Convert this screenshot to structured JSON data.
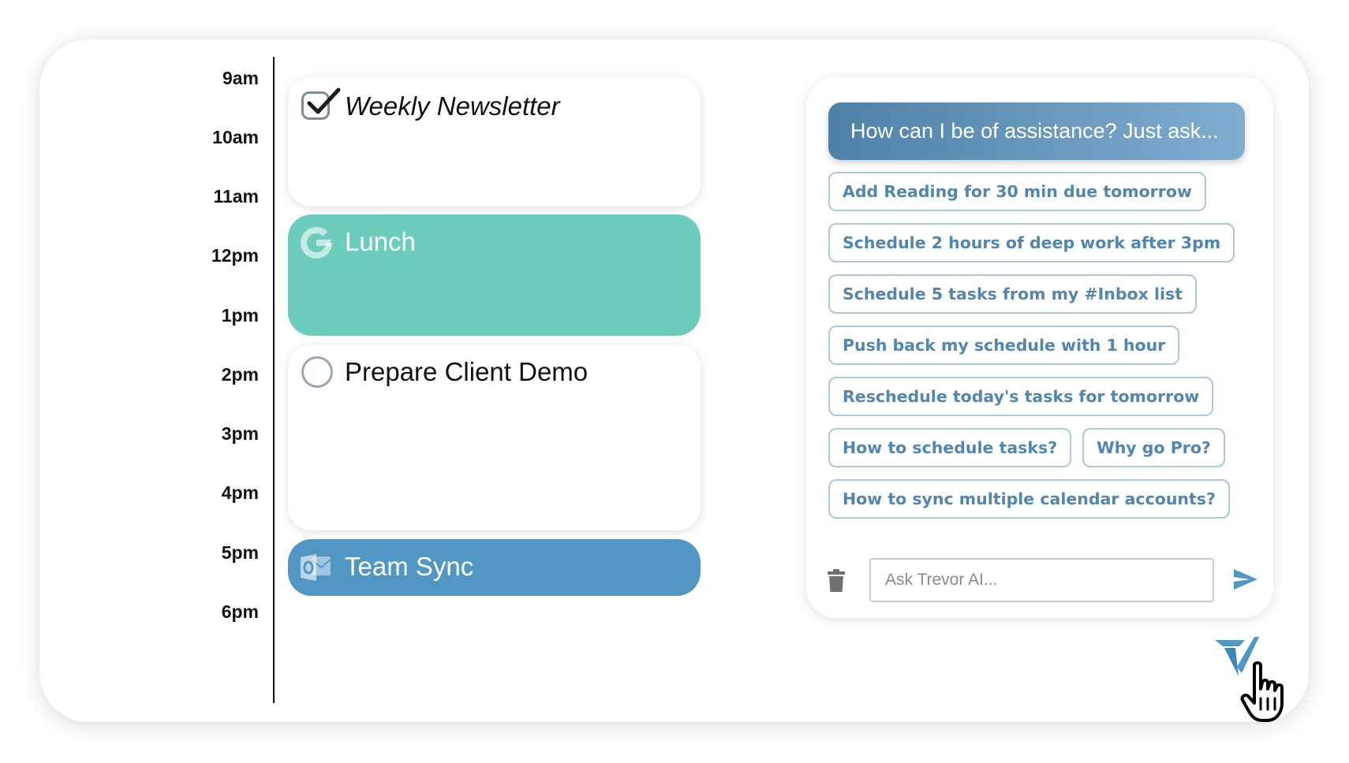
{
  "timeline": {
    "hours": [
      "9am",
      "10am",
      "11am",
      "12pm",
      "1pm",
      "2pm",
      "3pm",
      "4pm",
      "5pm",
      "6pm"
    ]
  },
  "events": {
    "weekly_newsletter": {
      "title": "Weekly Newsletter",
      "completed": true,
      "icon": "checkbox-checked-icon"
    },
    "lunch": {
      "title": "Lunch",
      "source": "google",
      "icon": "google-icon",
      "color": "#6ccdbc"
    },
    "prepare_client_demo": {
      "title": "Prepare Client Demo",
      "completed": false,
      "icon": "checkbox-empty-icon"
    },
    "team_sync": {
      "title": "Team Sync",
      "source": "outlook",
      "icon": "outlook-icon",
      "color": "#5197c3"
    }
  },
  "assistant": {
    "header": "How can I be of assistance? Just ask...",
    "suggestions": [
      "Add Reading for 30 min due tomorrow",
      "Schedule 2 hours of deep work after 3pm",
      "Schedule 5 tasks from my #Inbox list",
      "Push back my schedule with 1 hour",
      "Reschedule today's tasks for tomorrow",
      "How to schedule tasks?",
      "Why go Pro?",
      "How to sync multiple calendar accounts?"
    ],
    "input_placeholder": "Ask Trevor AI...",
    "accent_color": "#5286b0"
  }
}
